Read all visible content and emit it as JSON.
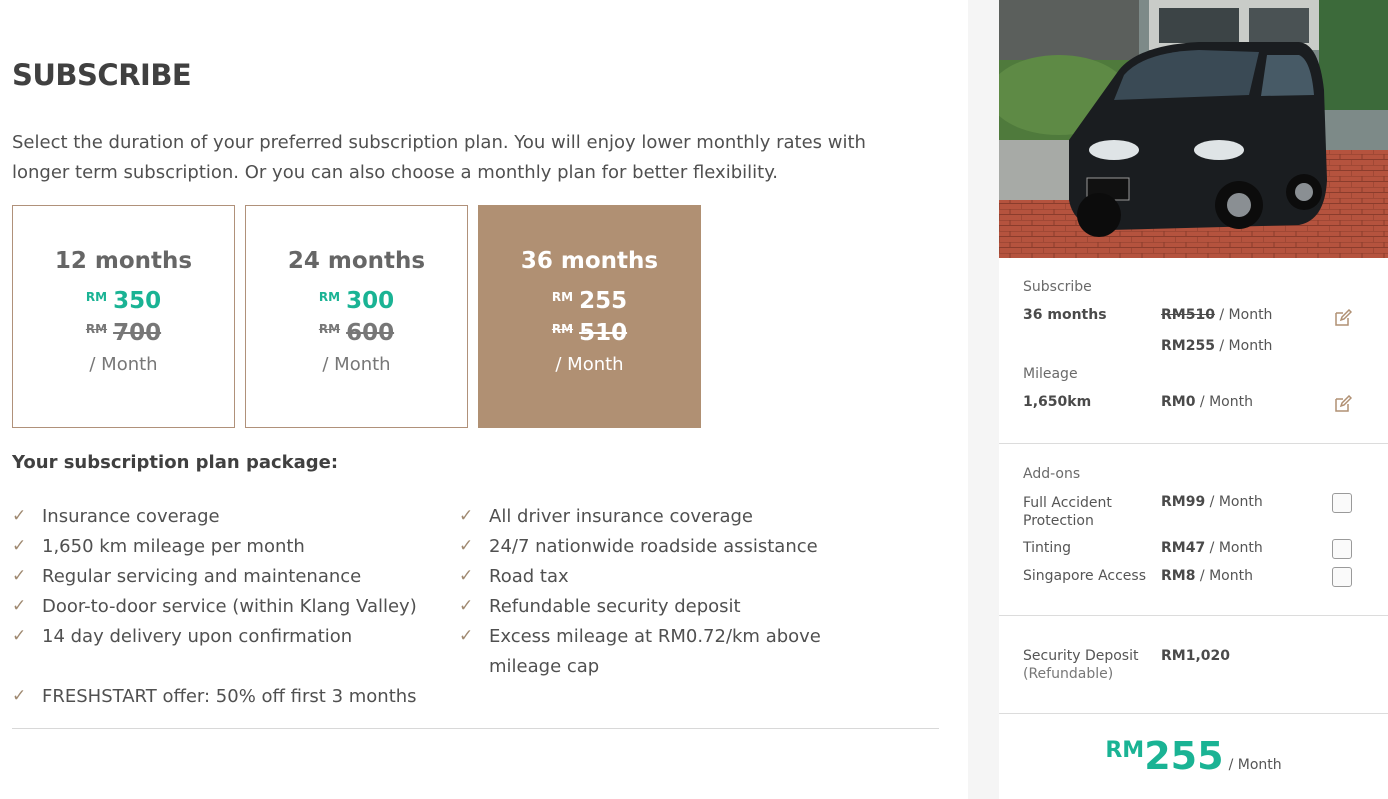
{
  "main": {
    "title": "SUBSCRIBE",
    "description": "Select the duration of your preferred subscription plan. You will enjoy lower monthly rates with longer term subscription. Or you can also choose a monthly plan for better flexibility.",
    "plans": [
      {
        "duration": "12 months",
        "currency": "RM",
        "price": "350",
        "old_currency": "RM",
        "old_price": "700",
        "per": "/ Month",
        "selected": false
      },
      {
        "duration": "24 months",
        "currency": "RM",
        "price": "300",
        "old_currency": "RM",
        "old_price": "600",
        "per": "/ Month",
        "selected": false
      },
      {
        "duration": "36 months",
        "currency": "RM",
        "price": "255",
        "old_currency": "RM",
        "old_price": "510",
        "per": "/ Month",
        "selected": true
      }
    ],
    "package_title": "Your subscription plan package:",
    "features_left": [
      "Insurance coverage",
      "1,650 km mileage per month",
      "Regular servicing and maintenance",
      "Door-to-door service (within Klang Valley)",
      "14 day delivery upon confirmation",
      "FRESHSTART offer: 50% off first 3 months"
    ],
    "features_right": [
      "All driver insurance coverage",
      "24/7 nationwide roadside assistance",
      "Road tax",
      "Refundable security deposit",
      "Excess mileage at RM0.72/km above mileage cap"
    ]
  },
  "summary": {
    "subscribe_label": "Subscribe",
    "subscribe_value": "36 months",
    "subscribe_old_price": "RM510",
    "subscribe_new_price": "RM255",
    "per_month": " / Month",
    "mileage_label": "Mileage",
    "mileage_value": "1,650km",
    "mileage_price": "RM0",
    "addons_label": "Add-ons",
    "addons": [
      {
        "name": "Full Accident Protection",
        "price": "RM99",
        "checked": false
      },
      {
        "name": "Tinting",
        "price": "RM47",
        "checked": false
      },
      {
        "name": "Singapore Access",
        "price": "RM8",
        "checked": false
      }
    ],
    "deposit_label": "Security Deposit",
    "deposit_sub": "(Refundable)",
    "deposit_value": "RM1,020",
    "total_currency": "RM",
    "total_amount": "255",
    "total_per": "/ Month"
  },
  "colors": {
    "accent_green": "#1ab394",
    "selected_plan": "#b09073",
    "plan_border": "#b0917a",
    "check_icon": "#a08a72"
  },
  "icons": {
    "check": "check-icon",
    "edit": "edit-icon",
    "checkbox": "checkbox-icon"
  }
}
